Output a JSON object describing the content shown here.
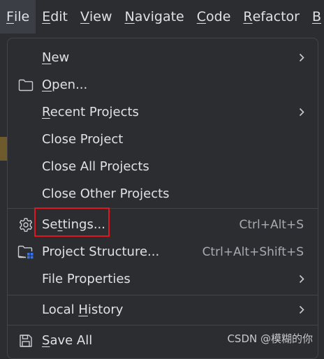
{
  "menubar": {
    "items": [
      {
        "pre": "",
        "mn": "F",
        "post": "ile",
        "active": true
      },
      {
        "pre": "",
        "mn": "E",
        "post": "dit"
      },
      {
        "pre": "",
        "mn": "V",
        "post": "iew"
      },
      {
        "pre": "",
        "mn": "N",
        "post": "avigate"
      },
      {
        "pre": "",
        "mn": "C",
        "post": "ode"
      },
      {
        "pre": "",
        "mn": "R",
        "post": "efactor"
      },
      {
        "pre": "",
        "mn": "B",
        "post": ""
      }
    ]
  },
  "file_menu": {
    "new": {
      "pre": "",
      "mn": "N",
      "post": "ew"
    },
    "open": {
      "pre": "",
      "mn": "O",
      "post": "pen..."
    },
    "recent_projects": {
      "pre": "",
      "mn": "R",
      "post": "ecent Projects"
    },
    "close_project": {
      "label": "Close Project"
    },
    "close_all_projects": {
      "label": "Close All Projects"
    },
    "close_other_projects": {
      "label": "Close Other Projects"
    },
    "settings": {
      "pre": "Se",
      "mn": "t",
      "post": "tings...",
      "shortcut": "Ctrl+Alt+S"
    },
    "project_structure": {
      "label": "Project Structure...",
      "shortcut": "Ctrl+Alt+Shift+S"
    },
    "file_properties": {
      "label": "File Properties"
    },
    "local_history": {
      "pre": "Local ",
      "mn": "H",
      "post": "istory"
    },
    "save_all": {
      "pre": "",
      "mn": "S",
      "post": "ave All"
    }
  },
  "watermark": "CSDN @模糊的你",
  "colors": {
    "background": "#2b2d30",
    "text": "#dfe1e5",
    "shortcut_text": "#a7aab0",
    "highlight_box": "#e0161d",
    "separator": "#43454a",
    "accent_blue": "#3574f0"
  },
  "icons": {
    "open": "folder-icon",
    "settings": "gear-icon",
    "project_structure": "folder-grid-icon",
    "save_all": "floppy-disk-icon",
    "submenu": "chevron-right-icon"
  }
}
